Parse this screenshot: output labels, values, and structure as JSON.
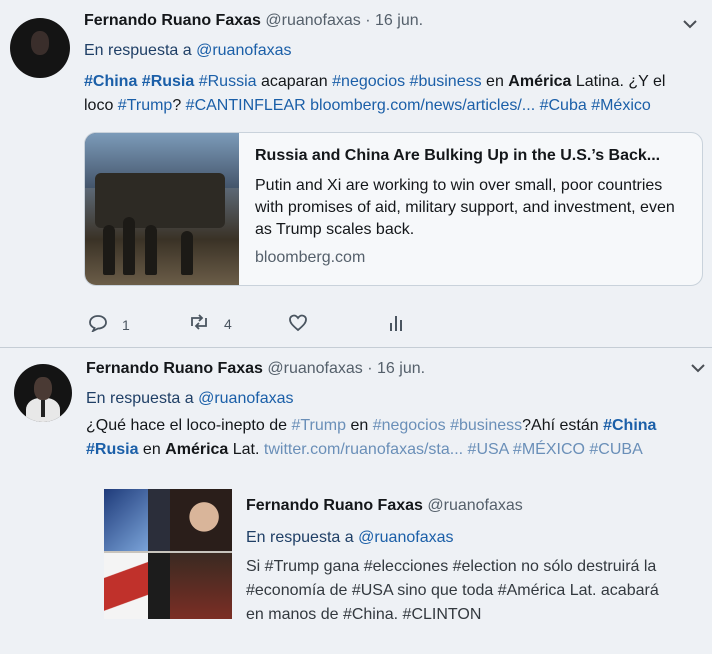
{
  "tweets": [
    {
      "name": "Fernando Ruano Faxas",
      "handle": "@ruanofaxas",
      "dot": "·",
      "date": "16 jun.",
      "reply_prefix": "En respuesta a",
      "reply_handle": "@ruanofaxas",
      "text": {
        "l1": {
          "china": "#China",
          "rusia": "#Rusia",
          "russia": "#Russia",
          "t1": " acaparan ",
          "negocios": "#negocios",
          "business": "#business",
          "t2": " en ",
          "america": "América",
          "t3": " Latina. ¿Y el"
        },
        "l2": {
          "t1": "loco ",
          "trump": "#Trump",
          "t2": "? ",
          "cantinflear": "#CANTINFLEAR",
          "link": "bloomberg.com/news/articles/...",
          "cuba": "#Cuba",
          "mexico": "#México"
        }
      },
      "card": {
        "title": "Russia and China Are Bulking Up in the U.S.’s Back...",
        "description": "Putin and Xi are working to win over small, poor countries with promises of aid, military support, and investment, even as Trump scales back.",
        "domain": "bloomberg.com"
      },
      "actions": {
        "reply_count": "1",
        "retweet_count": "4"
      }
    },
    {
      "name": "Fernando Ruano Faxas",
      "handle": "@ruanofaxas",
      "dot": "·",
      "date": "16 jun.",
      "reply_prefix": "En respuesta a",
      "reply_handle": "@ruanofaxas",
      "text": {
        "l1": {
          "t1": "¿Qué hace el loco-inepto de ",
          "trump": "#Trump",
          "t2": " en ",
          "negocios": "#negocios",
          "business": "#business",
          "t3": "?Ahí están ",
          "china": "#China"
        },
        "l2": {
          "rusia": "#Rusia",
          "t1": " en ",
          "america": "América",
          "t2": " Lat. ",
          "link": "twitter.com/ruanofaxas/sta...",
          "usa": "#USA",
          "mexico": "#MÉXICO",
          "cuba": "#CUBA"
        }
      },
      "quote": {
        "name": "Fernando Ruano Faxas",
        "handle": "@ruanofaxas",
        "reply_prefix": "En respuesta a",
        "reply_handle": "@ruanofaxas",
        "lines": [
          "Si #Trump gana #elecciones #election no sólo destruirá la",
          "#economía de #USA sino que toda #América Lat. acabará",
          "en manos de #China. #CLINTON"
        ]
      }
    }
  ],
  "colors": {
    "link": "#1b5fa8",
    "background": "#eef1f5",
    "text": "#14171a"
  },
  "icons": [
    "chevron-down-icon",
    "reply-icon",
    "retweet-icon",
    "like-icon",
    "analytics-icon"
  ]
}
